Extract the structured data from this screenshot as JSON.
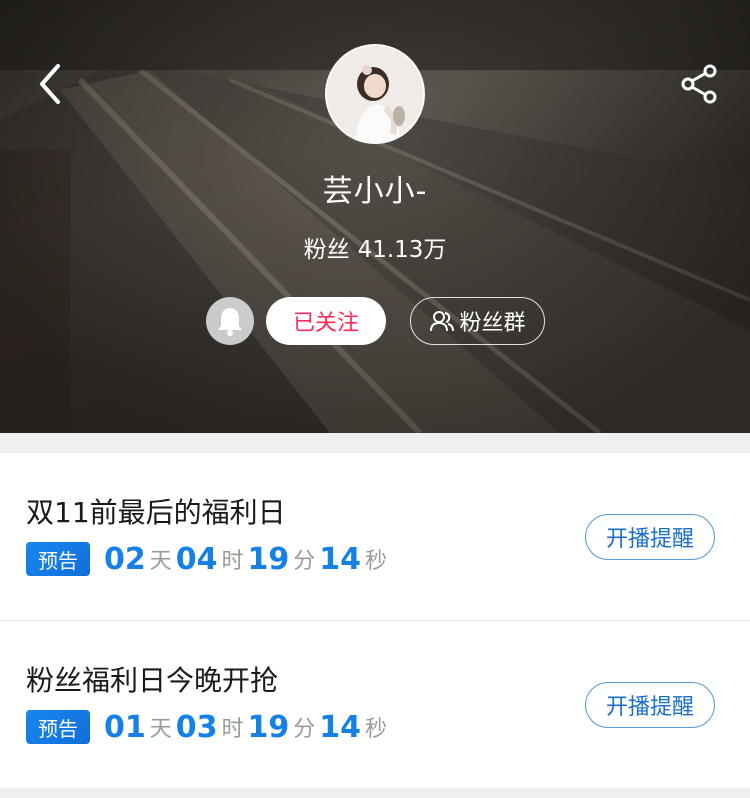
{
  "header": {
    "anchor_name": "芸小小-",
    "fans_label": "粉丝",
    "fans_count": "41.13万",
    "follow_label": "已关注",
    "fan_group_label": "粉丝群",
    "icons": {
      "back": "chevron-left-icon",
      "share": "share-icon",
      "bell": "bell-icon",
      "fan_group": "group-icon"
    }
  },
  "events": [
    {
      "title": "双11前最后的福利日",
      "badge": "预告",
      "countdown": {
        "days": "02",
        "day_unit": "天",
        "hours": "04",
        "hour_unit": "时",
        "minutes": "19",
        "minute_unit": "分",
        "seconds": "14",
        "second_unit": "秒"
      },
      "remind_label": "开播提醒"
    },
    {
      "title": "粉丝福利日今晚开抢",
      "badge": "预告",
      "countdown": {
        "days": "01",
        "day_unit": "天",
        "hours": "03",
        "hour_unit": "时",
        "minutes": "19",
        "minute_unit": "分",
        "seconds": "14",
        "second_unit": "秒"
      },
      "remind_label": "开播提醒"
    }
  ],
  "colors": {
    "accent_blue": "#1580e6",
    "follow_red": "#ff2a55",
    "badge_blue": "#1a86f0"
  }
}
